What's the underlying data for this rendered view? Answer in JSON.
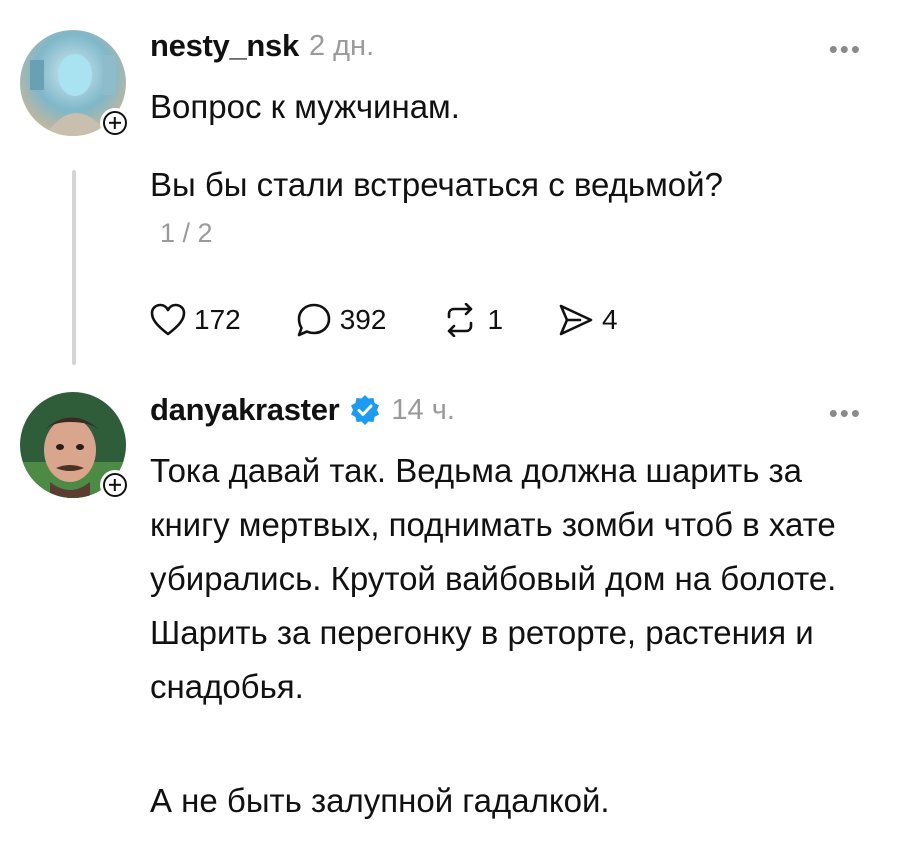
{
  "post1": {
    "username": "nesty_nsk",
    "time": "2 дн.",
    "more_icon": "more-dots-icon",
    "line1": "Вопрос к мужчинам.",
    "line2": "Вы бы стали встречаться с ведьмой?",
    "pager": "1 / 2",
    "likes": "172",
    "comments": "392",
    "reposts": "1",
    "shares": "4"
  },
  "post2": {
    "username": "danyakraster",
    "verified_icon": "verified-badge-icon",
    "time": "14 ч.",
    "body": "Тока давай так. Ведьма должна шарить за книгу мертвых, поднимать зомби чтоб в хате убирались. Крутой вайбовый дом на болоте. Шарить за перегонку в реторте, растения и снадобья.",
    "body_end": "А не быть залупной гадалкой."
  },
  "colors": {
    "text": "#111111",
    "muted": "#9a9a9a",
    "verified": "#1d9bf0",
    "thread_line": "#d6d6d6"
  }
}
